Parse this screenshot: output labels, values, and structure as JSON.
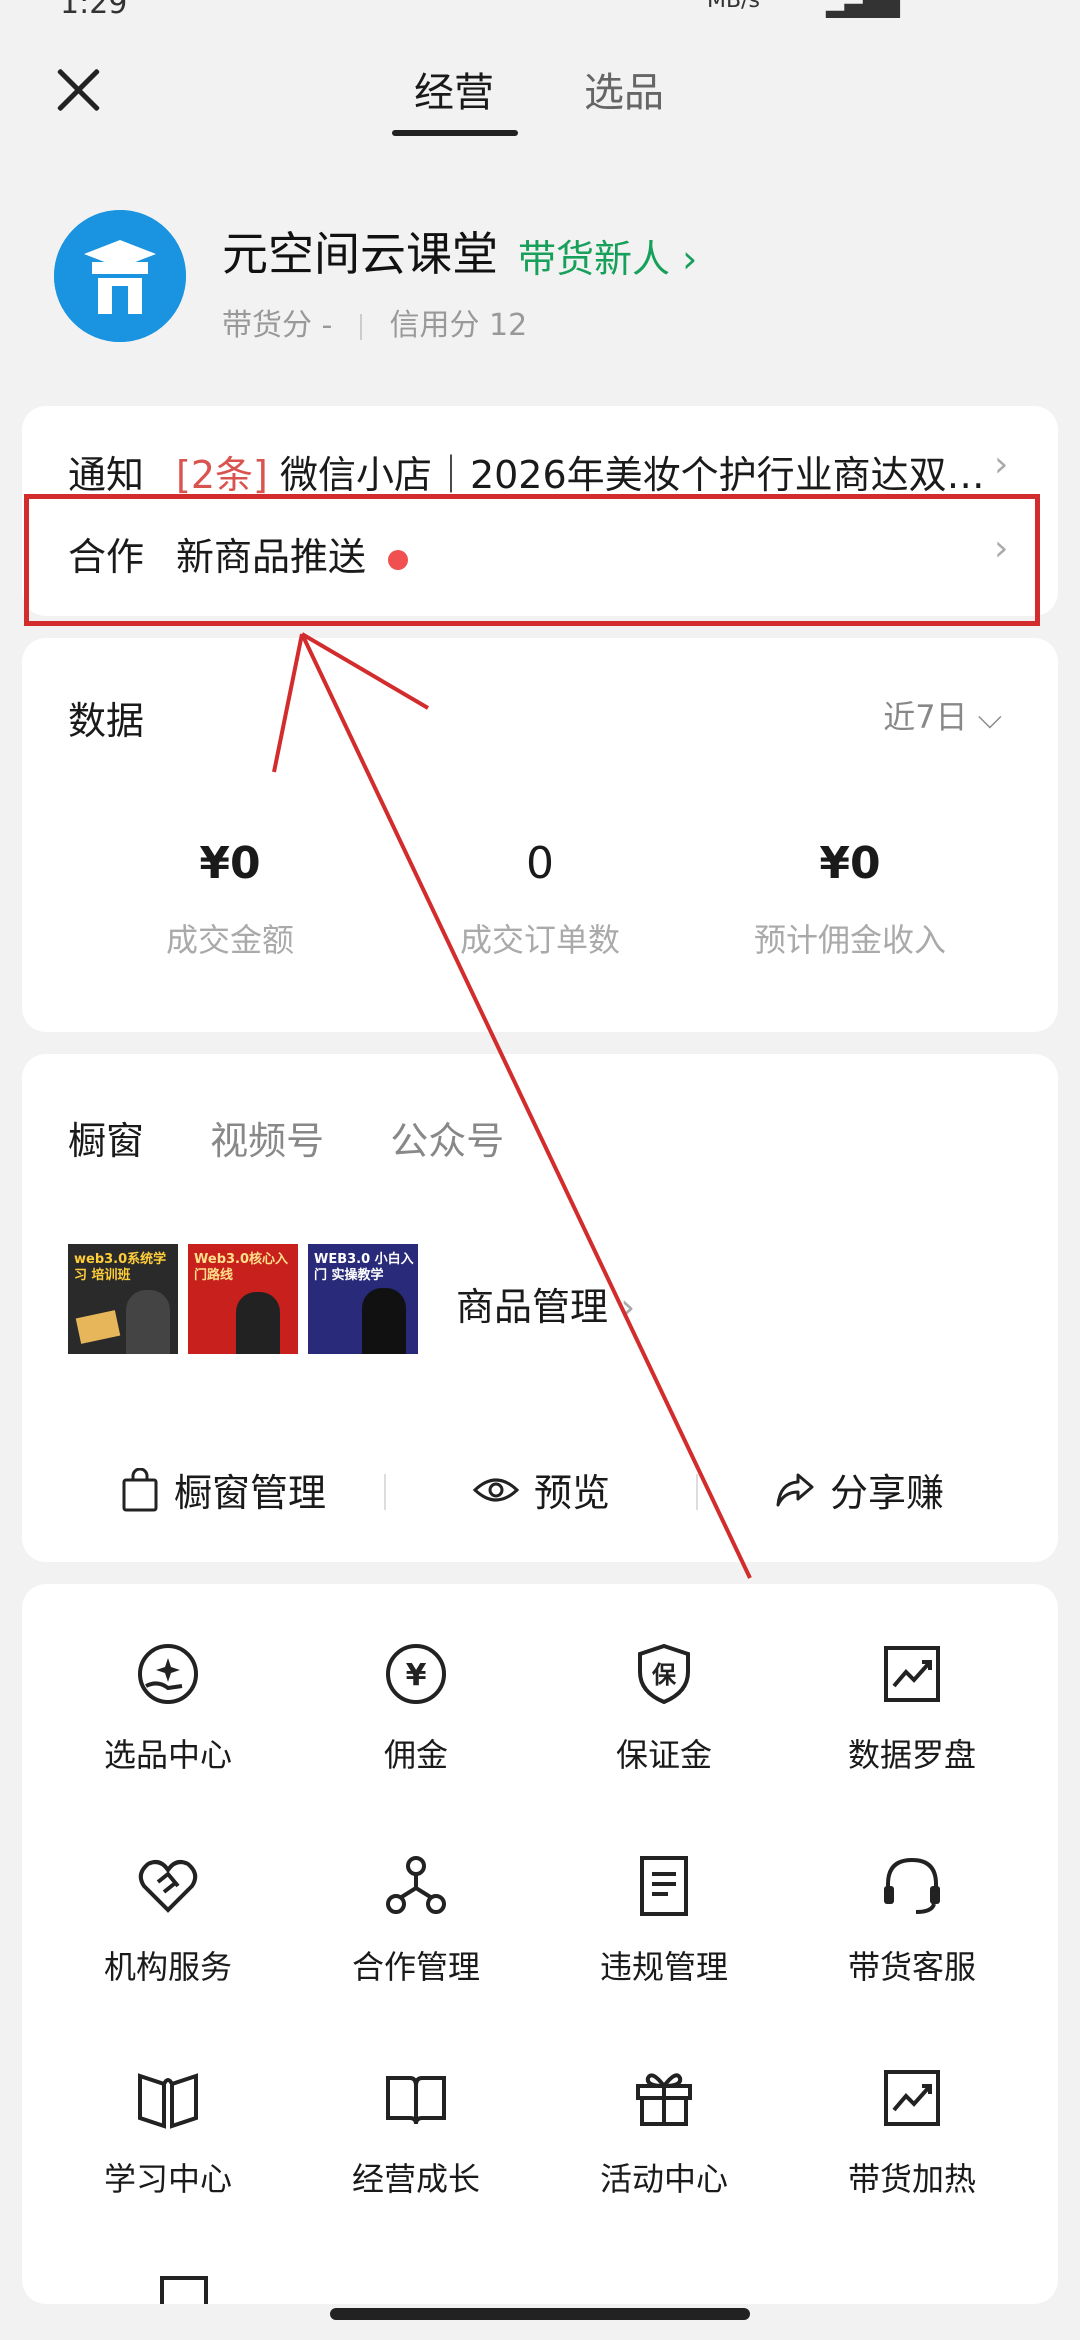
{
  "status_bar": {
    "time": "1:29",
    "network": "MB/s"
  },
  "nav": {
    "tabs": [
      "经营",
      "选品"
    ],
    "active_tab": "经营"
  },
  "profile": {
    "shop_name": "元空间云课堂",
    "tier_link": "带货新人",
    "goods_score_label": "带货分",
    "goods_score_value": "-",
    "credit_score_label": "信用分",
    "credit_score_value": "12",
    "avatar_color": "#1a94e0"
  },
  "notice": {
    "label": "通知",
    "count": "[2条]",
    "text": "微信小店｜2026年美妆个护行业商达双…"
  },
  "cooperation": {
    "label": "合作",
    "text": "新商品推送"
  },
  "data": {
    "title": "数据",
    "range": "近7日",
    "metrics": [
      {
        "value": "¥0",
        "label": "成交金额"
      },
      {
        "value": "0",
        "label": "成交订单数"
      },
      {
        "value": "¥0",
        "label": "预计佣金收入"
      }
    ]
  },
  "showcase": {
    "tabs": [
      "橱窗",
      "视频号",
      "公众号"
    ],
    "thumbs": [
      {
        "title": "web3.0系统学习 培训班"
      },
      {
        "title": "Web3.0核心入门路线"
      },
      {
        "title": "WEB3.0 小白入门 实操教学"
      }
    ],
    "product_management": "商品管理",
    "actions": [
      "橱窗管理",
      "预览",
      "分享赚"
    ]
  },
  "tools": [
    {
      "label": "选品中心",
      "icon": "hand-star-icon"
    },
    {
      "label": "佣金",
      "icon": "yen-circle-icon"
    },
    {
      "label": "保证金",
      "icon": "shield-bao-icon"
    },
    {
      "label": "数据罗盘",
      "icon": "chart-trend-icon"
    },
    {
      "label": "机构服务",
      "icon": "heart-handshake-icon"
    },
    {
      "label": "合作管理",
      "icon": "nodes-icon"
    },
    {
      "label": "违规管理",
      "icon": "document-icon"
    },
    {
      "label": "带货客服",
      "icon": "headset-icon"
    },
    {
      "label": "学习中心",
      "icon": "open-book-icon"
    },
    {
      "label": "经营成长",
      "icon": "book-icon"
    },
    {
      "label": "活动中心",
      "icon": "gift-icon"
    },
    {
      "label": "带货加热",
      "icon": "chart-trend-icon"
    }
  ]
}
